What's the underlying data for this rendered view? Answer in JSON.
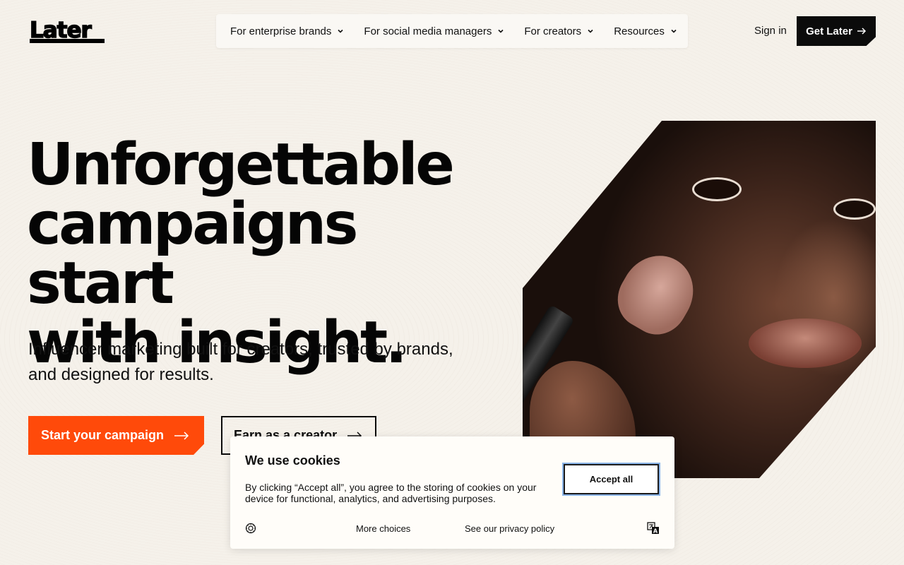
{
  "brand": {
    "logo_text": "Later",
    "accent": "#ff4a0a"
  },
  "nav": {
    "items": [
      {
        "label": "For enterprise brands"
      },
      {
        "label": "For social media managers"
      },
      {
        "label": "For creators"
      },
      {
        "label": "Resources"
      }
    ],
    "sign_in": "Sign in",
    "get_later": "Get Later"
  },
  "hero": {
    "headline_line1": "Unforgettable",
    "headline_line2": "campaigns start",
    "headline_line3": "with insight.",
    "subheadline": "Influencer marketing built for creators, trusted by brands, and designed for results.",
    "primary_cta": "Start your campaign",
    "secondary_cta": "Earn as a creator"
  },
  "cookie": {
    "title": "We use cookies",
    "text": "By clicking “Accept all”, you agree to the storing of cookies on your device for functional, analytics, and advertising purposes.",
    "accept": "Accept all",
    "more_choices": "More choices",
    "privacy": "See our privacy policy"
  }
}
